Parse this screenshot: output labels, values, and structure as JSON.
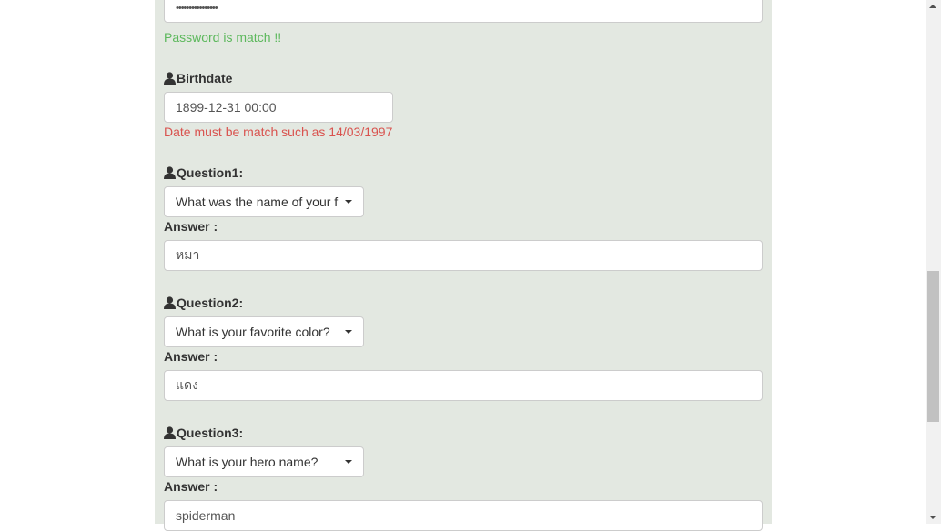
{
  "password": {
    "masked_value": "••••••••••••••••",
    "status_message": "Password is match !!",
    "status_color": "#5cb85c"
  },
  "birthdate": {
    "label": "Birthdate",
    "value": "1899-12-31 00:00",
    "error_message": "Date must be match such as 14/03/1997",
    "error_color": "#d9534f"
  },
  "questions": [
    {
      "label": "Question1:",
      "selected": "What was the name of your fi",
      "answer_label": "Answer :",
      "answer": "หมา"
    },
    {
      "label": "Question2:",
      "selected": "What is your favorite color?",
      "answer_label": "Answer :",
      "answer": "แดง"
    },
    {
      "label": "Question3:",
      "selected": "What is your hero name?",
      "answer_label": "Answer :",
      "answer": "spiderman"
    }
  ],
  "icons": {
    "field_label_icon": "person-icon",
    "dropdown_icon": "caret-down-icon"
  },
  "colors": {
    "panel_background": "#e3e8e1"
  }
}
